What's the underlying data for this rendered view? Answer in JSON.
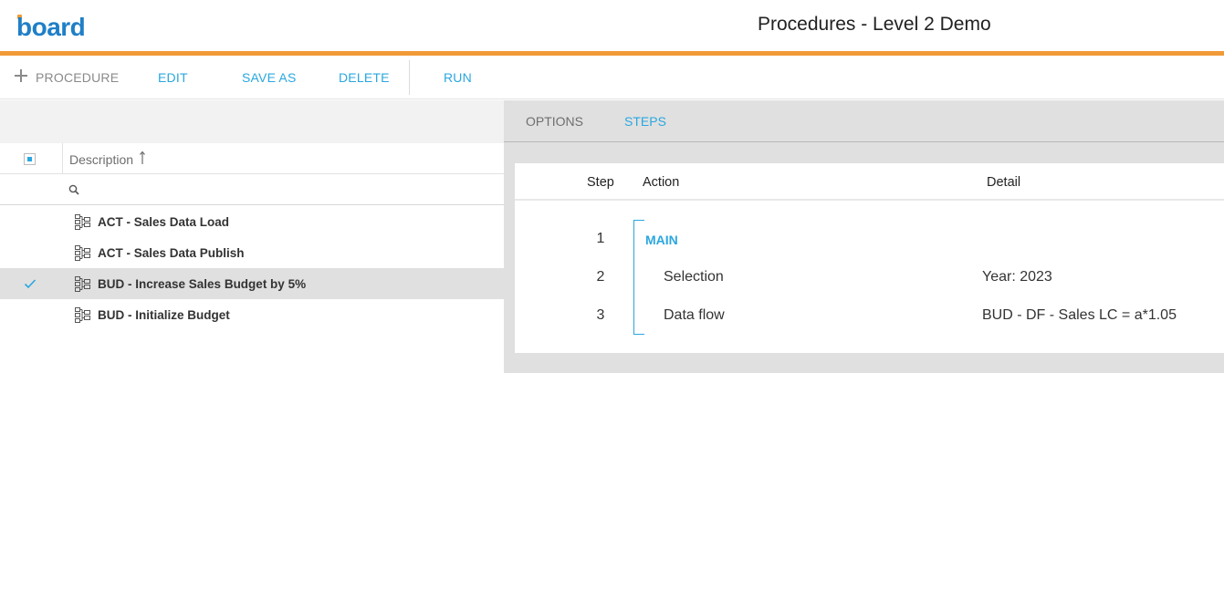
{
  "app": {
    "logo_text": "board",
    "title": "Procedures - Level 2 Demo",
    "accent": "#f29a38",
    "link_color": "#2aa7df"
  },
  "toolbar": {
    "procedure_label": "PROCEDURE",
    "edit_label": "EDIT",
    "save_as_label": "SAVE AS",
    "delete_label": "DELETE",
    "run_label": "RUN"
  },
  "procedure_list": {
    "column_header": "Description",
    "sort": "ascending",
    "search_placeholder": "",
    "items": [
      {
        "label": "ACT - Sales Data Load",
        "selected": false
      },
      {
        "label": "ACT - Sales Data Publish",
        "selected": false
      },
      {
        "label": "BUD - Increase Sales Budget by 5%",
        "selected": true
      },
      {
        "label": "BUD - Initialize Budget",
        "selected": false
      }
    ]
  },
  "detail_panel": {
    "tabs": [
      {
        "label": "OPTIONS",
        "active": false
      },
      {
        "label": "STEPS",
        "active": true
      }
    ],
    "columns": {
      "step": "Step",
      "action": "Action",
      "detail": "Detail"
    },
    "steps": [
      {
        "step": "1",
        "action": "MAIN",
        "detail": ""
      },
      {
        "step": "2",
        "action": "Selection",
        "detail": "Year: 2023"
      },
      {
        "step": "3",
        "action": "Data flow",
        "detail": "BUD - DF - Sales LC = a*1.05"
      }
    ]
  }
}
